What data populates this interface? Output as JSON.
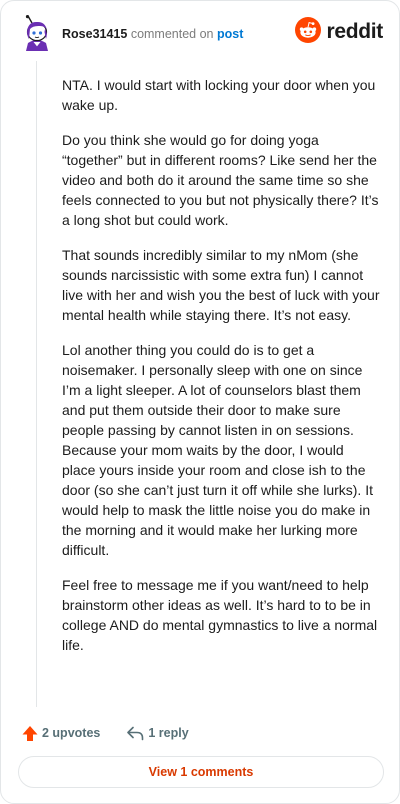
{
  "header": {
    "username": "Rose31415",
    "action_text": "commented on",
    "post_link": "post",
    "brand_name": "reddit",
    "avatar_icon": "snoo-avatar-icon",
    "brand_icon": "reddit-logo-icon",
    "brand_color": "#ff4500"
  },
  "comment": {
    "paragraphs": [
      "NTA. I would start with locking your door when you wake up.",
      "Do you think she would go for doing yoga “together” but in different rooms? Like send her the video and both do it around the same time so she feels connected to you but not physically there? It’s a long shot but could work.",
      "That sounds incredibly similar to my nMom (she sounds narcissistic with some extra fun) I cannot live with her and wish you the best of luck with your mental health while staying there. It’s not easy.",
      "Lol another thing you could do is to get a noisemaker. I personally sleep with one on since I’m a light sleeper. A lot of counselors blast them and put them outside their door to make sure people passing by cannot listen in on sessions. Because your mom waits by the door, I would place yours inside your room and close ish to the door (so she can’t just turn it off while she lurks). It would help to mask the little noise you do make in the morning and it would make her lurking more difficult.",
      "Feel free to message me if you want/need to help brainstorm other ideas as well. It’s hard to to be in college AND do mental gymnastics to live a normal life."
    ]
  },
  "actions": {
    "upvotes_label": "2 upvotes",
    "reply_label": "1 reply",
    "upvote_icon": "upvote-arrow-icon",
    "reply_icon": "reply-arrow-icon",
    "upvote_color": "#ff4500"
  },
  "footer": {
    "view_comments_label": "View 1 comments",
    "button_text_color": "#d93900"
  }
}
